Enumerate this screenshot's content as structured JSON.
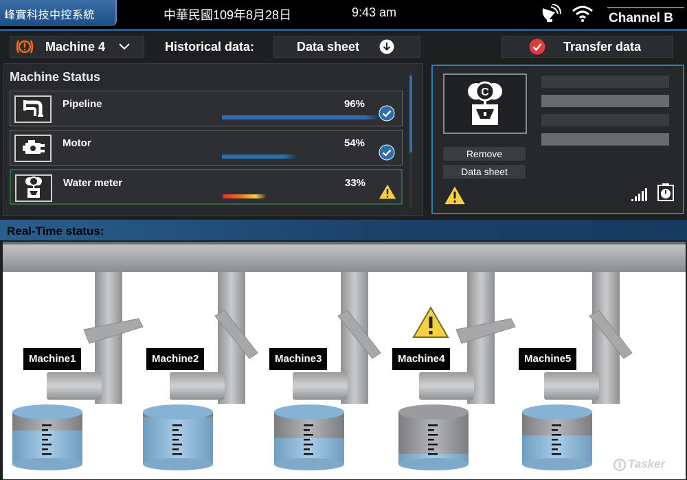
{
  "header": {
    "brand": "峰實科技中控系統",
    "date": "中華民國109年8月28日",
    "time": "9:43 am",
    "channel": "Channel B",
    "icons": [
      "satellite-dish-icon",
      "wifi-icon"
    ]
  },
  "toolbar": {
    "machine_select": "Machine 4",
    "historical_label": "Historical data:",
    "datasheet_label": "Data sheet",
    "transfer_label": "Transfer data",
    "colors": {
      "alert": "#f26b21",
      "transfer": "#e03b3b"
    }
  },
  "status": {
    "title": "Machine Status",
    "items": [
      {
        "label": "Pipeline",
        "percent": "96%",
        "progress": 0.96,
        "state": "ok",
        "icon": "pipeline-icon"
      },
      {
        "label": "Motor",
        "percent": "54%",
        "progress": 0.54,
        "state": "ok",
        "icon": "motor-icon"
      },
      {
        "label": "Water meter",
        "percent": "33%",
        "progress": 0.33,
        "state": "warning",
        "icon": "water-meter-icon"
      }
    ],
    "colors": {
      "ok_bar": "#2d6fae",
      "warn_bar": "#e03020",
      "check": "#2d6fae",
      "warning": "#f5d142"
    }
  },
  "detail": {
    "remove_label": "Remove",
    "datasheet_label": "Data sheet",
    "icons": [
      "water-meter-icon",
      "warning-icon",
      "signal-icon",
      "timer-icon"
    ]
  },
  "realtime": {
    "label": "Real-Time status:",
    "machines": [
      {
        "name": "Machine1",
        "level": 0.65
      },
      {
        "name": "Machine2",
        "level": 0.9
      },
      {
        "name": "Machine3",
        "level": 0.5
      },
      {
        "name": "Machine4",
        "level": 0.2,
        "warning": true
      },
      {
        "name": "Machine5",
        "level": 0.55
      }
    ]
  },
  "watermark": "Tasker"
}
